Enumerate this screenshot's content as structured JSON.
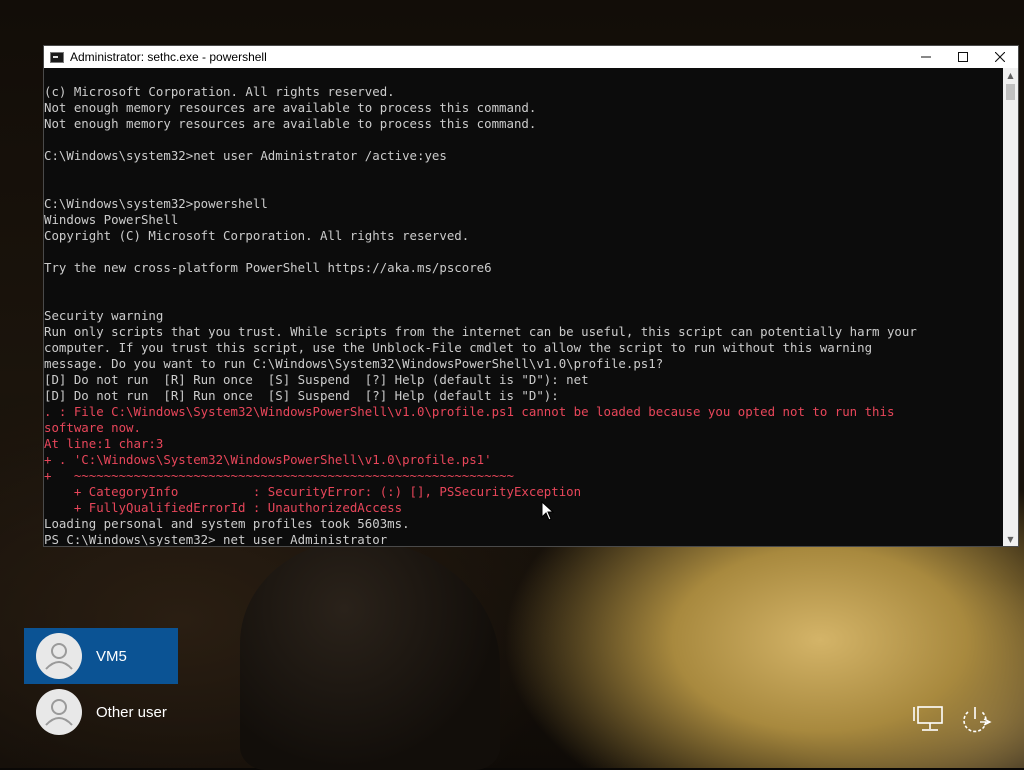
{
  "window": {
    "title": "Administrator: sethc.exe - powershell",
    "controls": {
      "minimize": "—",
      "maximize": "☐",
      "close": "✕"
    }
  },
  "terminal": {
    "lines": [
      {
        "text": "(c) Microsoft Corporation. All rights reserved.",
        "style": "normal"
      },
      {
        "text": "Not enough memory resources are available to process this command.",
        "style": "normal"
      },
      {
        "text": "Not enough memory resources are available to process this command.",
        "style": "normal"
      },
      {
        "text": "",
        "style": "normal"
      },
      {
        "text": "C:\\Windows\\system32>net user Administrator /active:yes",
        "style": "normal"
      },
      {
        "text": "",
        "style": "normal"
      },
      {
        "text": "",
        "style": "normal"
      },
      {
        "text": "C:\\Windows\\system32>powershell",
        "style": "normal"
      },
      {
        "text": "Windows PowerShell",
        "style": "normal"
      },
      {
        "text": "Copyright (C) Microsoft Corporation. All rights reserved.",
        "style": "normal"
      },
      {
        "text": "",
        "style": "normal"
      },
      {
        "text": "Try the new cross-platform PowerShell https://aka.ms/pscore6",
        "style": "normal"
      },
      {
        "text": "",
        "style": "normal"
      },
      {
        "text": "",
        "style": "normal"
      },
      {
        "text": "Security warning",
        "style": "normal"
      },
      {
        "text": "Run only scripts that you trust. While scripts from the internet can be useful, this script can potentially harm your",
        "style": "normal"
      },
      {
        "text": "computer. If you trust this script, use the Unblock-File cmdlet to allow the script to run without this warning",
        "style": "normal"
      },
      {
        "text": "message. Do you want to run C:\\Windows\\System32\\WindowsPowerShell\\v1.0\\profile.ps1?",
        "style": "normal"
      },
      {
        "text": "[D] Do not run  [R] Run once  [S] Suspend  [?] Help (default is \"D\"): net",
        "style": "normal"
      },
      {
        "text": "[D] Do not run  [R] Run once  [S] Suspend  [?] Help (default is \"D\"):",
        "style": "normal"
      },
      {
        "text": ". : File C:\\Windows\\System32\\WindowsPowerShell\\v1.0\\profile.ps1 cannot be loaded because you opted not to run this",
        "style": "error"
      },
      {
        "text": "software now.",
        "style": "error"
      },
      {
        "text": "At line:1 char:3",
        "style": "error"
      },
      {
        "text": "+ . 'C:\\Windows\\System32\\WindowsPowerShell\\v1.0\\profile.ps1'",
        "style": "error"
      },
      {
        "text": "+   ~~~~~~~~~~~~~~~~~~~~~~~~~~~~~~~~~~~~~~~~~~~~~~~~~~~~~~~~~~~",
        "style": "error"
      },
      {
        "text": "    + CategoryInfo          : SecurityError: (:) [], PSSecurityException",
        "style": "error"
      },
      {
        "text": "    + FullyQualifiedErrorId : UnauthorizedAccess",
        "style": "error"
      },
      {
        "text": "Loading personal and system profiles took 5603ms.",
        "style": "normal"
      },
      {
        "text": "PS C:\\Windows\\system32> net user Administrator",
        "style": "normal"
      }
    ]
  },
  "users": [
    {
      "name": "VM5",
      "selected": true
    },
    {
      "name": "Other user",
      "selected": false
    }
  ],
  "colors": {
    "terminal_bg": "#0c0c0c",
    "terminal_text": "#cccccc",
    "error_text": "#e8465a",
    "selected_user_bg": "#0b5394"
  },
  "icons": {
    "network": "network-icon",
    "power": "power-icon"
  }
}
